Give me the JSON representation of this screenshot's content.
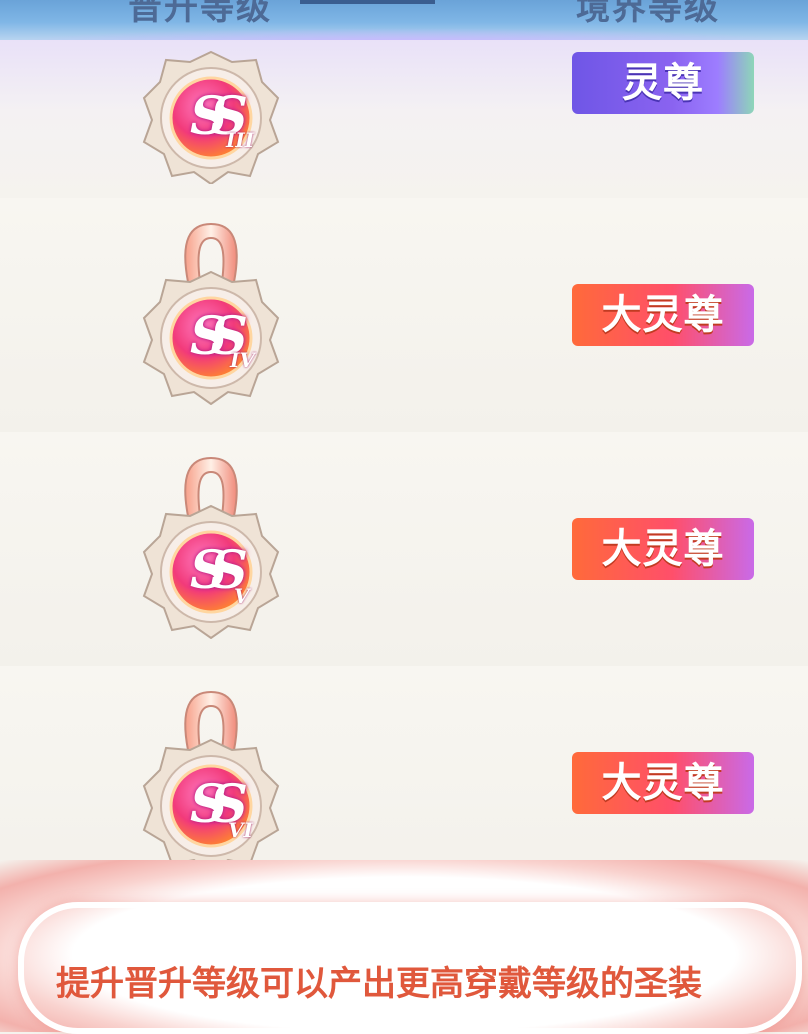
{
  "header": {
    "col_left": "晋升等级",
    "col_right": "境界等级"
  },
  "rows": [
    {
      "badge_letters": "SS",
      "roman": "III",
      "has_ribbon": false,
      "realm": "灵尊",
      "tag_color": "purple"
    },
    {
      "badge_letters": "SS",
      "roman": "IV",
      "has_ribbon": true,
      "realm": "大灵尊",
      "tag_color": "orange"
    },
    {
      "badge_letters": "SS",
      "roman": "V",
      "has_ribbon": true,
      "realm": "大灵尊",
      "tag_color": "orange"
    },
    {
      "badge_letters": "SS",
      "roman": "VI",
      "has_ribbon": true,
      "realm": "大灵尊",
      "tag_color": "orange"
    }
  ],
  "footer": {
    "tip": "提升晋升等级可以产出更高穿戴等级的圣装"
  },
  "colors": {
    "header_blue": "#7fb6e6",
    "tag_purple": "#7a5cf0",
    "tag_orange": "#ff5a4a",
    "tip_text": "#e0583c"
  }
}
